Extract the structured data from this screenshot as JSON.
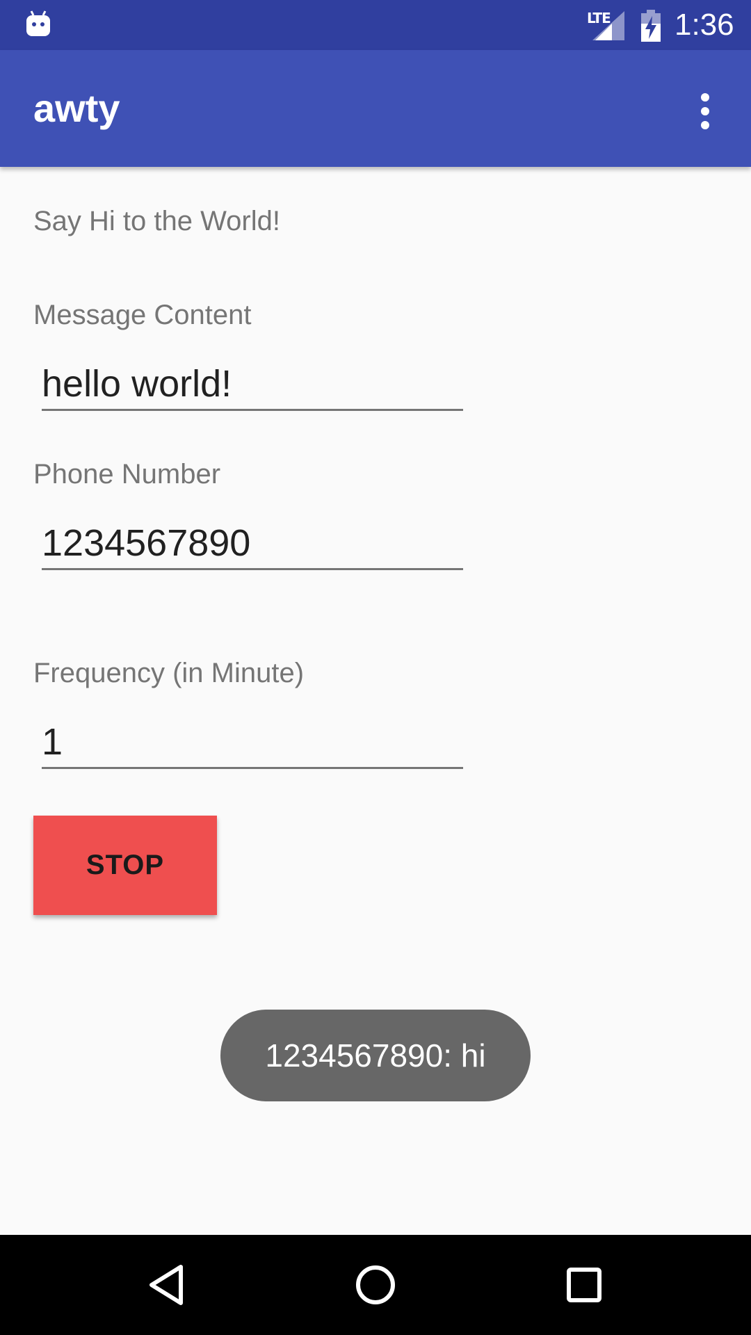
{
  "status_bar": {
    "network_label": "LTE",
    "time": "1:36"
  },
  "app_bar": {
    "title": "awty"
  },
  "content": {
    "heading": "Say Hi to the World!",
    "message_label": "Message Content",
    "message_value": "hello world!",
    "phone_label": "Phone Number",
    "phone_value": "1234567890",
    "frequency_label": "Frequency (in Minute)",
    "frequency_value": "1",
    "stop_button_label": "STOP"
  },
  "toast": {
    "text": "1234567890: hi"
  },
  "colors": {
    "status_bar": "#303f9f",
    "app_bar": "#3f51b5",
    "background": "#fafafa",
    "stop_button": "#ef4f4f",
    "toast": "#676767"
  },
  "icons": {
    "status_app": "android-robot-icon",
    "signal": "lte-signal-icon",
    "battery": "battery-charging-icon",
    "overflow": "more-vert-icon",
    "nav_back": "back-triangle-icon",
    "nav_home": "home-circle-icon",
    "nav_recents": "recents-square-icon"
  }
}
